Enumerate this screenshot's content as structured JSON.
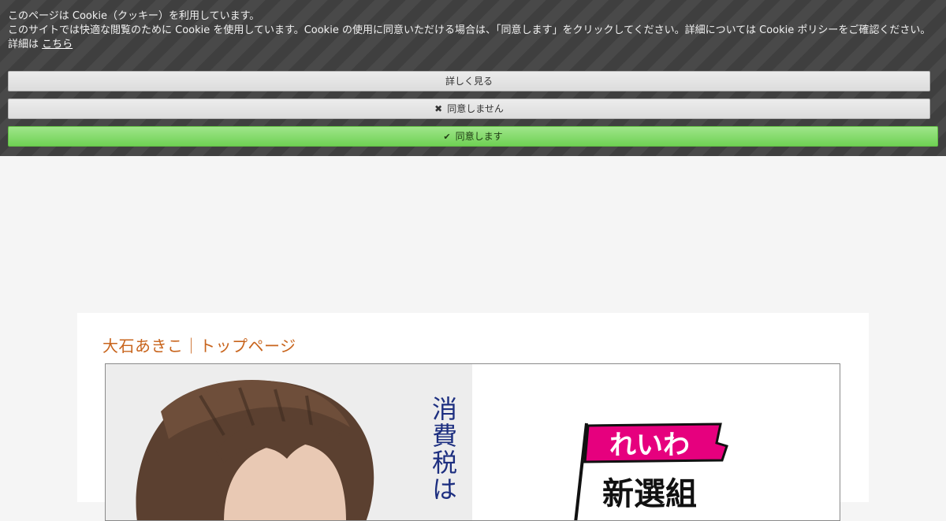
{
  "cookie_banner": {
    "line1": "このページは Cookie（クッキー）を利用しています。",
    "line2": "このサイトでは快適な閲覧のために Cookie を使用しています。Cookie の使用に同意いただける場合は、「同意します」をクリックしてください。詳細については Cookie ポリシーをご確認ください。",
    "line3_prefix": "詳細は",
    "line3_link": "こちら",
    "details_button": "詳しく見る",
    "decline_button": "同意しません",
    "accept_button": "同意します",
    "decline_icon": "✖",
    "accept_icon": "✔"
  },
  "page": {
    "title": "大石あきこ｜トップページ"
  },
  "hero": {
    "slogan": "消費税は",
    "logo_text_top": "れいわ",
    "logo_text_bottom": "新選組",
    "colors": {
      "logo_pink": "#e6007e",
      "slogan_blue": "#1d2f80",
      "title_orange": "#c8641c"
    }
  }
}
